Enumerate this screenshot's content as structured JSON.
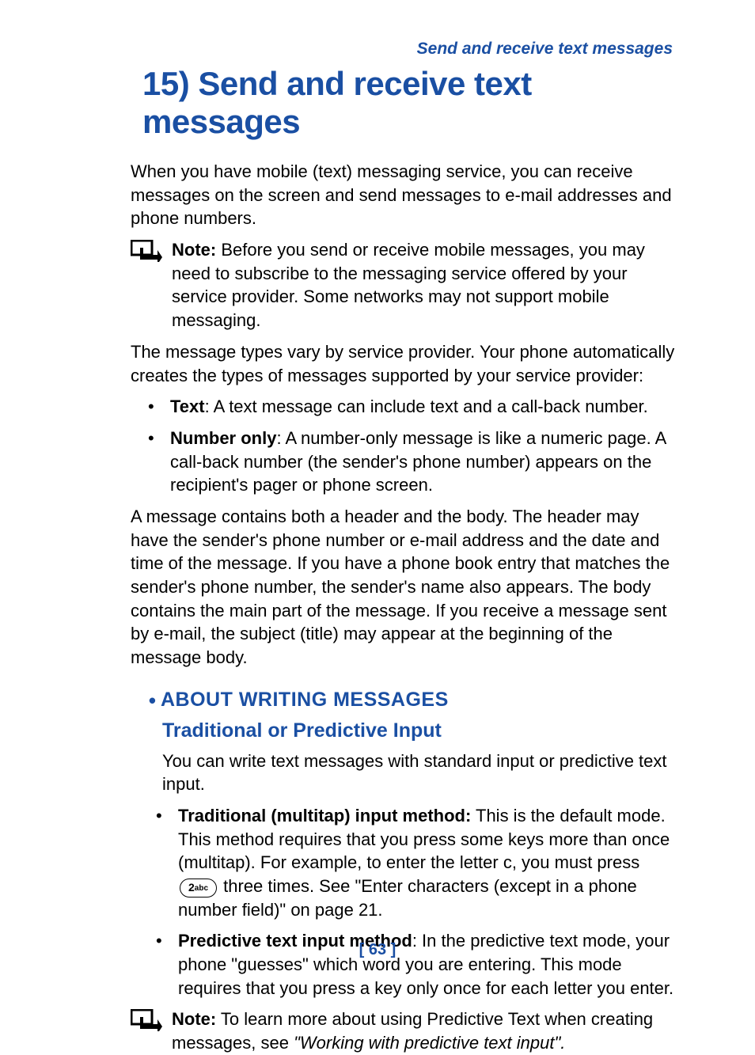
{
  "header": {
    "running": "Send and receive text messages"
  },
  "title": "15) Send and receive text messages",
  "intro": "When you have mobile (text) messaging service, you can receive messages on the screen and send messages to e-mail addresses and phone numbers.",
  "note1": {
    "label": "Note:",
    "text": " Before you send or receive mobile messages, you may need to subscribe to the messaging service offered by your service provider. Some networks may not support mobile messaging."
  },
  "para2": "The message types vary by service provider. Your phone automatically creates the types of messages supported by your service provider:",
  "types": [
    {
      "label": "Text",
      "text": ": A text message can include text and a call-back number."
    },
    {
      "label": "Number only",
      "text": ": A number-only message is like a numeric page. A call-back number (the sender's phone number) appears on the recipient's pager or phone screen."
    }
  ],
  "para3": "A message contains both a header and the body. The header may have the sender's phone number or e-mail address and the date and time of the message. If you have a phone book entry that matches the sender's phone number, the sender's name also appears. The body contains the main part of the message. If you receive a message sent by e-mail, the subject (title) may appear at the beginning of the message body.",
  "h2": "ABOUT WRITING MESSAGES",
  "h3": "Traditional or Predictive Input",
  "para4": "You can write text messages with standard input or predictive text input.",
  "methods": [
    {
      "label": "Traditional (multitap) input method:",
      "pre": " This is the default mode. This method requires that you press some keys more than once (multitap). For example, to enter the letter c, you must press ",
      "key_num": "2",
      "key_letters": "abc",
      "post": " three times. See \"Enter characters (except in a phone number field)\" on page 21."
    },
    {
      "label": "Predictive text input method",
      "text": ": In the predictive text mode, your phone \"guesses\" which word you are entering. This mode requires that you press a key only once for each letter you enter."
    }
  ],
  "note2": {
    "label": "Note:",
    "pre": " To learn more about using Predictive Text when creating messages, see ",
    "ref": "\"Working with predictive text input\"."
  },
  "page_number": "[ 63 ]"
}
